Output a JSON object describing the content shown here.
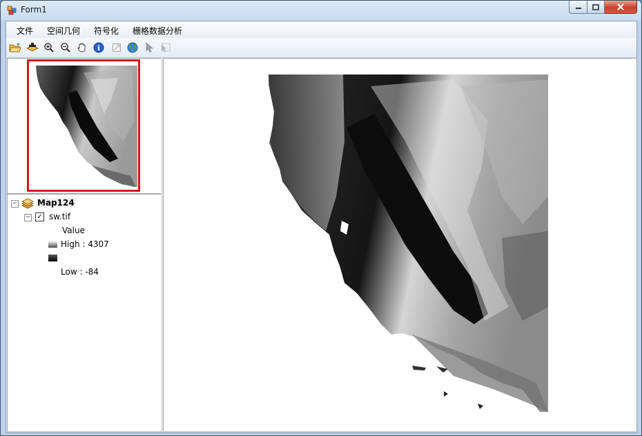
{
  "window": {
    "title": "Form1",
    "icon": "winform-app-icon"
  },
  "menu": [
    "文件",
    "空间几何",
    "符号化",
    "栅格数据分析"
  ],
  "toolbar": [
    "open-folder-icon",
    "add-data-icon",
    "zoom-in-icon",
    "zoom-out-icon",
    "pan-hand-icon",
    "identify-info-icon",
    "full-extent-icon",
    "globe-icon",
    "select-pointer-icon",
    "select-features-icon"
  ],
  "toc": {
    "map_name": "Map124",
    "layer_name": "sw.tif",
    "layer_checked": true,
    "legend_title": "Value",
    "high_label": "High : 4307",
    "low_label": "Low : -84"
  },
  "colors": {
    "overview_extent": "#d11a1a",
    "raster_high": "#ffffff",
    "raster_low": "#000000"
  }
}
